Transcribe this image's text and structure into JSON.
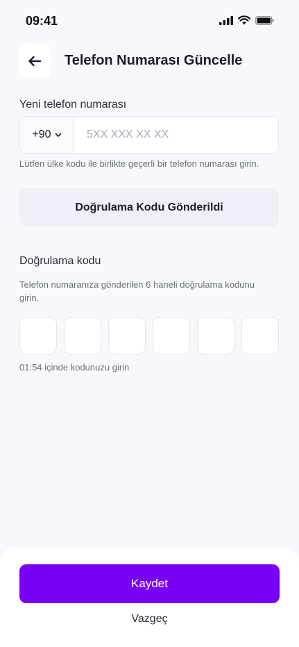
{
  "status_bar": {
    "time": "09:41",
    "icons": [
      "signal-icon",
      "wifi-icon",
      "battery-icon"
    ]
  },
  "header": {
    "back_icon": "arrow-left-icon",
    "title": "Telefon Numarası Güncelle"
  },
  "phone": {
    "label": "Yeni telefon numarası",
    "country_code": "+90",
    "country_icon": "chevron-down-icon",
    "value": "",
    "placeholder": "5XX XXX XX XX",
    "helper": "Lütfen ülke kodu ile birlikte geçerli bir telefon numarası girin."
  },
  "send_code": {
    "label": "Doğrulama Kodu Gönderildi"
  },
  "verification": {
    "label": "Doğrulama kodu",
    "description": "Telefon numaranıza gönderilen 6 haneli doğrulama kodunu girin.",
    "digits": [
      "",
      "",
      "",
      "",
      "",
      ""
    ],
    "timer_text": "01:54 içinde kodunuzu girin"
  },
  "actions": {
    "save_label": "Kaydet",
    "cancel_label": "Vazgeç"
  },
  "colors": {
    "primary": "#7a00f5",
    "background": "#f7f8fb",
    "code_sent_bg": "#f1eef8"
  }
}
